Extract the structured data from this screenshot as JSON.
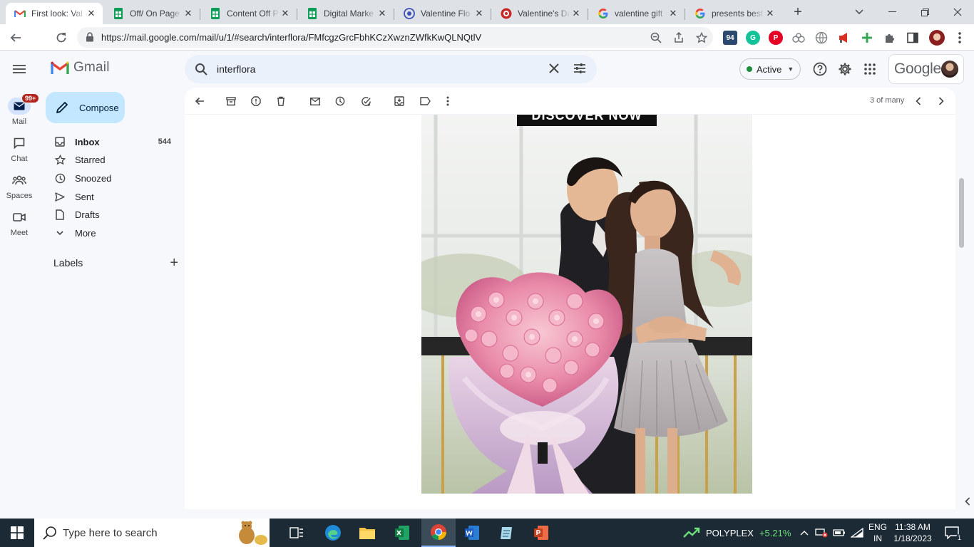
{
  "browser": {
    "tabs": [
      {
        "label": "First look: Val",
        "icon": "gmail-icon",
        "active": true
      },
      {
        "label": "Off/ On Page",
        "icon": "sheets-icon"
      },
      {
        "label": "Content Off P",
        "icon": "sheets-icon"
      },
      {
        "label": "Digital Marke",
        "icon": "sheets-icon"
      },
      {
        "label": "Valentine Flo",
        "icon": "site-icon"
      },
      {
        "label": "Valentine's Da",
        "icon": "site-icon"
      },
      {
        "label": "valentine gift",
        "icon": "google-icon"
      },
      {
        "label": "presents best",
        "icon": "google-icon"
      }
    ],
    "url": "https://mail.google.com/mail/u/1/#search/interflora/FMfcgzGrcFbhKCzXwznZWfkKwQLNQtlV",
    "extension_badge": "94"
  },
  "gmail": {
    "app_name": "Gmail",
    "search": {
      "value": "interflora"
    },
    "status": "Active",
    "account_brand": "Google",
    "rail": [
      {
        "label": "Mail",
        "icon": "mail-icon",
        "badge": "99+"
      },
      {
        "label": "Chat",
        "icon": "chat-icon"
      },
      {
        "label": "Spaces",
        "icon": "spaces-icon"
      },
      {
        "label": "Meet",
        "icon": "meet-icon"
      }
    ],
    "compose_label": "Compose",
    "nav": [
      {
        "label": "Inbox",
        "icon": "inbox-icon",
        "count": "544"
      },
      {
        "label": "Starred",
        "icon": "star-icon"
      },
      {
        "label": "Snoozed",
        "icon": "clock-icon"
      },
      {
        "label": "Sent",
        "icon": "send-icon"
      },
      {
        "label": "Drafts",
        "icon": "draft-icon"
      },
      {
        "label": "More",
        "icon": "chevron-down-icon"
      }
    ],
    "labels_heading": "Labels",
    "pager": "3 of many",
    "email": {
      "banner_text": "DISCOVER NOW"
    }
  },
  "taskbar": {
    "search_placeholder": "Type here to search",
    "stock_name": "POLYPLEX",
    "stock_change": "+5.21%",
    "language": [
      "ENG",
      "IN"
    ],
    "time": "11:38 AM",
    "date": "1/18/2023",
    "notification_count": "1"
  },
  "colors": {
    "accent": "#0b57d0",
    "compose_bg": "#c2e7ff",
    "taskbar": "#1c2a35"
  }
}
